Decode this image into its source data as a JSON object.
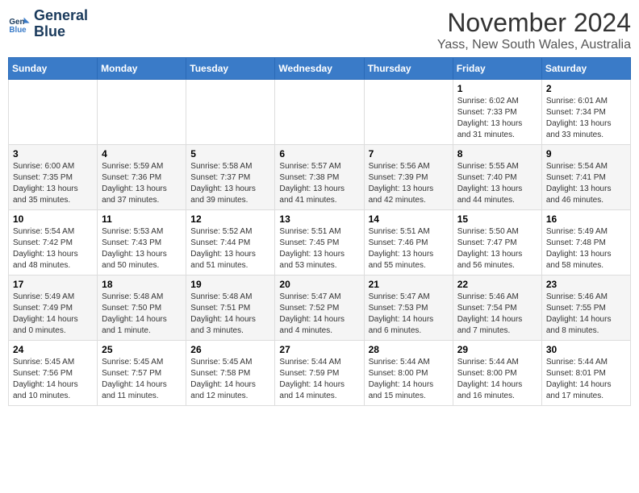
{
  "logo": {
    "line1": "General",
    "line2": "Blue"
  },
  "title": "November 2024",
  "subtitle": "Yass, New South Wales, Australia",
  "days_of_week": [
    "Sunday",
    "Monday",
    "Tuesday",
    "Wednesday",
    "Thursday",
    "Friday",
    "Saturday"
  ],
  "weeks": [
    [
      {
        "day": "",
        "info": ""
      },
      {
        "day": "",
        "info": ""
      },
      {
        "day": "",
        "info": ""
      },
      {
        "day": "",
        "info": ""
      },
      {
        "day": "",
        "info": ""
      },
      {
        "day": "1",
        "info": "Sunrise: 6:02 AM\nSunset: 7:33 PM\nDaylight: 13 hours and 31 minutes."
      },
      {
        "day": "2",
        "info": "Sunrise: 6:01 AM\nSunset: 7:34 PM\nDaylight: 13 hours and 33 minutes."
      }
    ],
    [
      {
        "day": "3",
        "info": "Sunrise: 6:00 AM\nSunset: 7:35 PM\nDaylight: 13 hours and 35 minutes."
      },
      {
        "day": "4",
        "info": "Sunrise: 5:59 AM\nSunset: 7:36 PM\nDaylight: 13 hours and 37 minutes."
      },
      {
        "day": "5",
        "info": "Sunrise: 5:58 AM\nSunset: 7:37 PM\nDaylight: 13 hours and 39 minutes."
      },
      {
        "day": "6",
        "info": "Sunrise: 5:57 AM\nSunset: 7:38 PM\nDaylight: 13 hours and 41 minutes."
      },
      {
        "day": "7",
        "info": "Sunrise: 5:56 AM\nSunset: 7:39 PM\nDaylight: 13 hours and 42 minutes."
      },
      {
        "day": "8",
        "info": "Sunrise: 5:55 AM\nSunset: 7:40 PM\nDaylight: 13 hours and 44 minutes."
      },
      {
        "day": "9",
        "info": "Sunrise: 5:54 AM\nSunset: 7:41 PM\nDaylight: 13 hours and 46 minutes."
      }
    ],
    [
      {
        "day": "10",
        "info": "Sunrise: 5:54 AM\nSunset: 7:42 PM\nDaylight: 13 hours and 48 minutes."
      },
      {
        "day": "11",
        "info": "Sunrise: 5:53 AM\nSunset: 7:43 PM\nDaylight: 13 hours and 50 minutes."
      },
      {
        "day": "12",
        "info": "Sunrise: 5:52 AM\nSunset: 7:44 PM\nDaylight: 13 hours and 51 minutes."
      },
      {
        "day": "13",
        "info": "Sunrise: 5:51 AM\nSunset: 7:45 PM\nDaylight: 13 hours and 53 minutes."
      },
      {
        "day": "14",
        "info": "Sunrise: 5:51 AM\nSunset: 7:46 PM\nDaylight: 13 hours and 55 minutes."
      },
      {
        "day": "15",
        "info": "Sunrise: 5:50 AM\nSunset: 7:47 PM\nDaylight: 13 hours and 56 minutes."
      },
      {
        "day": "16",
        "info": "Sunrise: 5:49 AM\nSunset: 7:48 PM\nDaylight: 13 hours and 58 minutes."
      }
    ],
    [
      {
        "day": "17",
        "info": "Sunrise: 5:49 AM\nSunset: 7:49 PM\nDaylight: 14 hours and 0 minutes."
      },
      {
        "day": "18",
        "info": "Sunrise: 5:48 AM\nSunset: 7:50 PM\nDaylight: 14 hours and 1 minute."
      },
      {
        "day": "19",
        "info": "Sunrise: 5:48 AM\nSunset: 7:51 PM\nDaylight: 14 hours and 3 minutes."
      },
      {
        "day": "20",
        "info": "Sunrise: 5:47 AM\nSunset: 7:52 PM\nDaylight: 14 hours and 4 minutes."
      },
      {
        "day": "21",
        "info": "Sunrise: 5:47 AM\nSunset: 7:53 PM\nDaylight: 14 hours and 6 minutes."
      },
      {
        "day": "22",
        "info": "Sunrise: 5:46 AM\nSunset: 7:54 PM\nDaylight: 14 hours and 7 minutes."
      },
      {
        "day": "23",
        "info": "Sunrise: 5:46 AM\nSunset: 7:55 PM\nDaylight: 14 hours and 8 minutes."
      }
    ],
    [
      {
        "day": "24",
        "info": "Sunrise: 5:45 AM\nSunset: 7:56 PM\nDaylight: 14 hours and 10 minutes."
      },
      {
        "day": "25",
        "info": "Sunrise: 5:45 AM\nSunset: 7:57 PM\nDaylight: 14 hours and 11 minutes."
      },
      {
        "day": "26",
        "info": "Sunrise: 5:45 AM\nSunset: 7:58 PM\nDaylight: 14 hours and 12 minutes."
      },
      {
        "day": "27",
        "info": "Sunrise: 5:44 AM\nSunset: 7:59 PM\nDaylight: 14 hours and 14 minutes."
      },
      {
        "day": "28",
        "info": "Sunrise: 5:44 AM\nSunset: 8:00 PM\nDaylight: 14 hours and 15 minutes."
      },
      {
        "day": "29",
        "info": "Sunrise: 5:44 AM\nSunset: 8:00 PM\nDaylight: 14 hours and 16 minutes."
      },
      {
        "day": "30",
        "info": "Sunrise: 5:44 AM\nSunset: 8:01 PM\nDaylight: 14 hours and 17 minutes."
      }
    ]
  ]
}
